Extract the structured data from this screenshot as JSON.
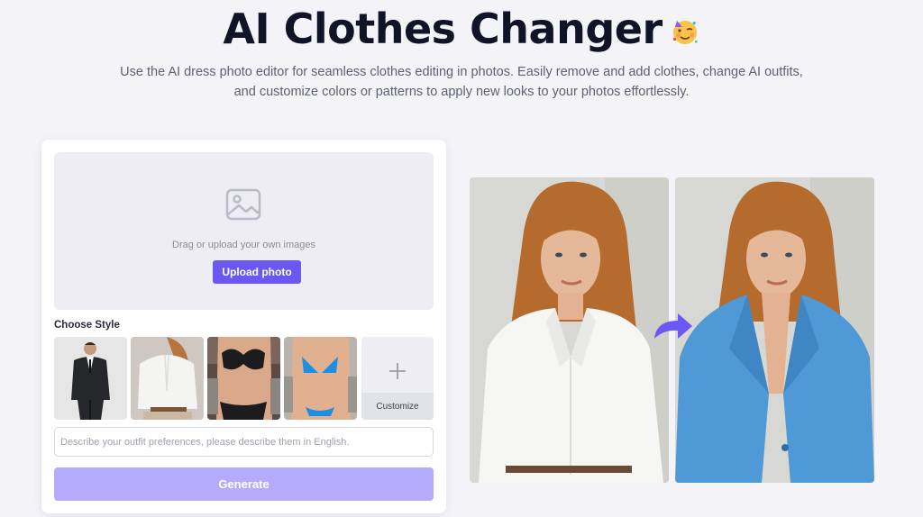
{
  "hero": {
    "title": "AI Clothes Changer",
    "emoji_icon": "party-face-icon",
    "subtitle_line1": "Use the AI dress photo editor for seamless clothes editing in photos. Easily remove and add clothes, change AI outfits,",
    "subtitle_line2": "and customize colors or patterns to apply new looks to your photos effortlessly."
  },
  "upload": {
    "icon": "image-icon",
    "hint": "Drag or upload your own images",
    "button_label": "Upload photo"
  },
  "styles": {
    "label": "Choose Style",
    "items": [
      {
        "name": "black-suit-style"
      },
      {
        "name": "white-shirt-style"
      },
      {
        "name": "black-lingerie-style"
      },
      {
        "name": "blue-bikini-style"
      }
    ],
    "customize_label": "Customize"
  },
  "prompt": {
    "placeholder": "Describe your outfit preferences, please describe them in English.",
    "value": ""
  },
  "generate": {
    "label": "Generate"
  },
  "preview": {
    "before_image": "woman-white-shirt-photo",
    "after_image": "woman-blue-blazer-photo",
    "arrow_icon": "curved-arrow-right-icon"
  },
  "colors": {
    "accent": "#6a57f4",
    "accent_disabled": "#b5abfb",
    "page_bg": "#f3f3f8",
    "title": "#111327"
  }
}
